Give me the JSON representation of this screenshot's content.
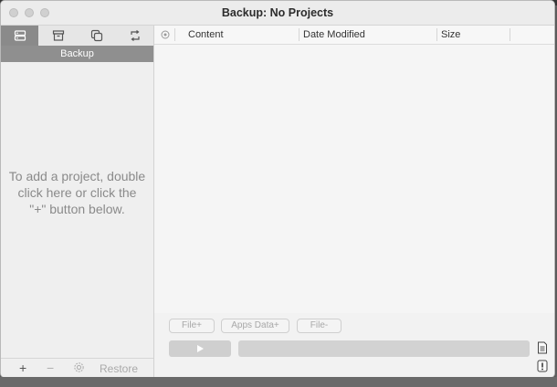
{
  "window": {
    "title": "Backup: No Projects"
  },
  "sidebar": {
    "tabs": [
      {
        "icon": "server-stack-icon",
        "active": true
      },
      {
        "icon": "archive-box-icon",
        "active": false
      },
      {
        "icon": "copy-icon",
        "active": false
      },
      {
        "icon": "sync-icon",
        "active": false
      }
    ],
    "section_header": "Backup",
    "empty_hint": "To add a project, double click here or click the \"+\" button below.",
    "footer": {
      "add_label": "+",
      "remove_label": "−",
      "settings_icon": "gear-icon",
      "restore_label": "Restore"
    }
  },
  "table": {
    "columns": [
      "Content",
      "Date Modified",
      "Size"
    ],
    "status_icon": "circle-x-icon"
  },
  "controls": {
    "file_add_label": "File+",
    "apps_data_add_label": "Apps Data+",
    "file_remove_label": "File-",
    "play_icon": "play-icon",
    "log_icon": "document-icon",
    "alert_icon": "exclamation-icon"
  },
  "colors": {
    "active_tab": "#8a8a8a",
    "section_header": "#8f8f8f",
    "window_bg": "#f2f2f2"
  }
}
